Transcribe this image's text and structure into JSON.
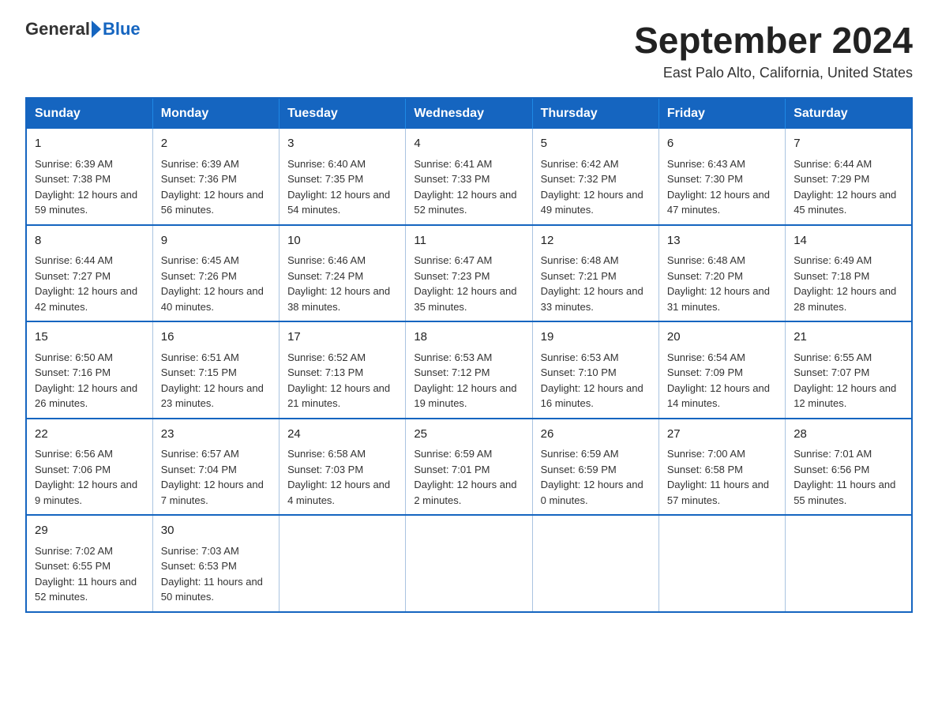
{
  "logo": {
    "text_general": "General",
    "text_blue": "Blue"
  },
  "title": "September 2024",
  "subtitle": "East Palo Alto, California, United States",
  "days_of_week": [
    "Sunday",
    "Monday",
    "Tuesday",
    "Wednesday",
    "Thursday",
    "Friday",
    "Saturday"
  ],
  "weeks": [
    [
      {
        "day": "1",
        "sunrise": "6:39 AM",
        "sunset": "7:38 PM",
        "daylight": "12 hours and 59 minutes."
      },
      {
        "day": "2",
        "sunrise": "6:39 AM",
        "sunset": "7:36 PM",
        "daylight": "12 hours and 56 minutes."
      },
      {
        "day": "3",
        "sunrise": "6:40 AM",
        "sunset": "7:35 PM",
        "daylight": "12 hours and 54 minutes."
      },
      {
        "day": "4",
        "sunrise": "6:41 AM",
        "sunset": "7:33 PM",
        "daylight": "12 hours and 52 minutes."
      },
      {
        "day": "5",
        "sunrise": "6:42 AM",
        "sunset": "7:32 PM",
        "daylight": "12 hours and 49 minutes."
      },
      {
        "day": "6",
        "sunrise": "6:43 AM",
        "sunset": "7:30 PM",
        "daylight": "12 hours and 47 minutes."
      },
      {
        "day": "7",
        "sunrise": "6:44 AM",
        "sunset": "7:29 PM",
        "daylight": "12 hours and 45 minutes."
      }
    ],
    [
      {
        "day": "8",
        "sunrise": "6:44 AM",
        "sunset": "7:27 PM",
        "daylight": "12 hours and 42 minutes."
      },
      {
        "day": "9",
        "sunrise": "6:45 AM",
        "sunset": "7:26 PM",
        "daylight": "12 hours and 40 minutes."
      },
      {
        "day": "10",
        "sunrise": "6:46 AM",
        "sunset": "7:24 PM",
        "daylight": "12 hours and 38 minutes."
      },
      {
        "day": "11",
        "sunrise": "6:47 AM",
        "sunset": "7:23 PM",
        "daylight": "12 hours and 35 minutes."
      },
      {
        "day": "12",
        "sunrise": "6:48 AM",
        "sunset": "7:21 PM",
        "daylight": "12 hours and 33 minutes."
      },
      {
        "day": "13",
        "sunrise": "6:48 AM",
        "sunset": "7:20 PM",
        "daylight": "12 hours and 31 minutes."
      },
      {
        "day": "14",
        "sunrise": "6:49 AM",
        "sunset": "7:18 PM",
        "daylight": "12 hours and 28 minutes."
      }
    ],
    [
      {
        "day": "15",
        "sunrise": "6:50 AM",
        "sunset": "7:16 PM",
        "daylight": "12 hours and 26 minutes."
      },
      {
        "day": "16",
        "sunrise": "6:51 AM",
        "sunset": "7:15 PM",
        "daylight": "12 hours and 23 minutes."
      },
      {
        "day": "17",
        "sunrise": "6:52 AM",
        "sunset": "7:13 PM",
        "daylight": "12 hours and 21 minutes."
      },
      {
        "day": "18",
        "sunrise": "6:53 AM",
        "sunset": "7:12 PM",
        "daylight": "12 hours and 19 minutes."
      },
      {
        "day": "19",
        "sunrise": "6:53 AM",
        "sunset": "7:10 PM",
        "daylight": "12 hours and 16 minutes."
      },
      {
        "day": "20",
        "sunrise": "6:54 AM",
        "sunset": "7:09 PM",
        "daylight": "12 hours and 14 minutes."
      },
      {
        "day": "21",
        "sunrise": "6:55 AM",
        "sunset": "7:07 PM",
        "daylight": "12 hours and 12 minutes."
      }
    ],
    [
      {
        "day": "22",
        "sunrise": "6:56 AM",
        "sunset": "7:06 PM",
        "daylight": "12 hours and 9 minutes."
      },
      {
        "day": "23",
        "sunrise": "6:57 AM",
        "sunset": "7:04 PM",
        "daylight": "12 hours and 7 minutes."
      },
      {
        "day": "24",
        "sunrise": "6:58 AM",
        "sunset": "7:03 PM",
        "daylight": "12 hours and 4 minutes."
      },
      {
        "day": "25",
        "sunrise": "6:59 AM",
        "sunset": "7:01 PM",
        "daylight": "12 hours and 2 minutes."
      },
      {
        "day": "26",
        "sunrise": "6:59 AM",
        "sunset": "6:59 PM",
        "daylight": "12 hours and 0 minutes."
      },
      {
        "day": "27",
        "sunrise": "7:00 AM",
        "sunset": "6:58 PM",
        "daylight": "11 hours and 57 minutes."
      },
      {
        "day": "28",
        "sunrise": "7:01 AM",
        "sunset": "6:56 PM",
        "daylight": "11 hours and 55 minutes."
      }
    ],
    [
      {
        "day": "29",
        "sunrise": "7:02 AM",
        "sunset": "6:55 PM",
        "daylight": "11 hours and 52 minutes."
      },
      {
        "day": "30",
        "sunrise": "7:03 AM",
        "sunset": "6:53 PM",
        "daylight": "11 hours and 50 minutes."
      },
      null,
      null,
      null,
      null,
      null
    ]
  ]
}
